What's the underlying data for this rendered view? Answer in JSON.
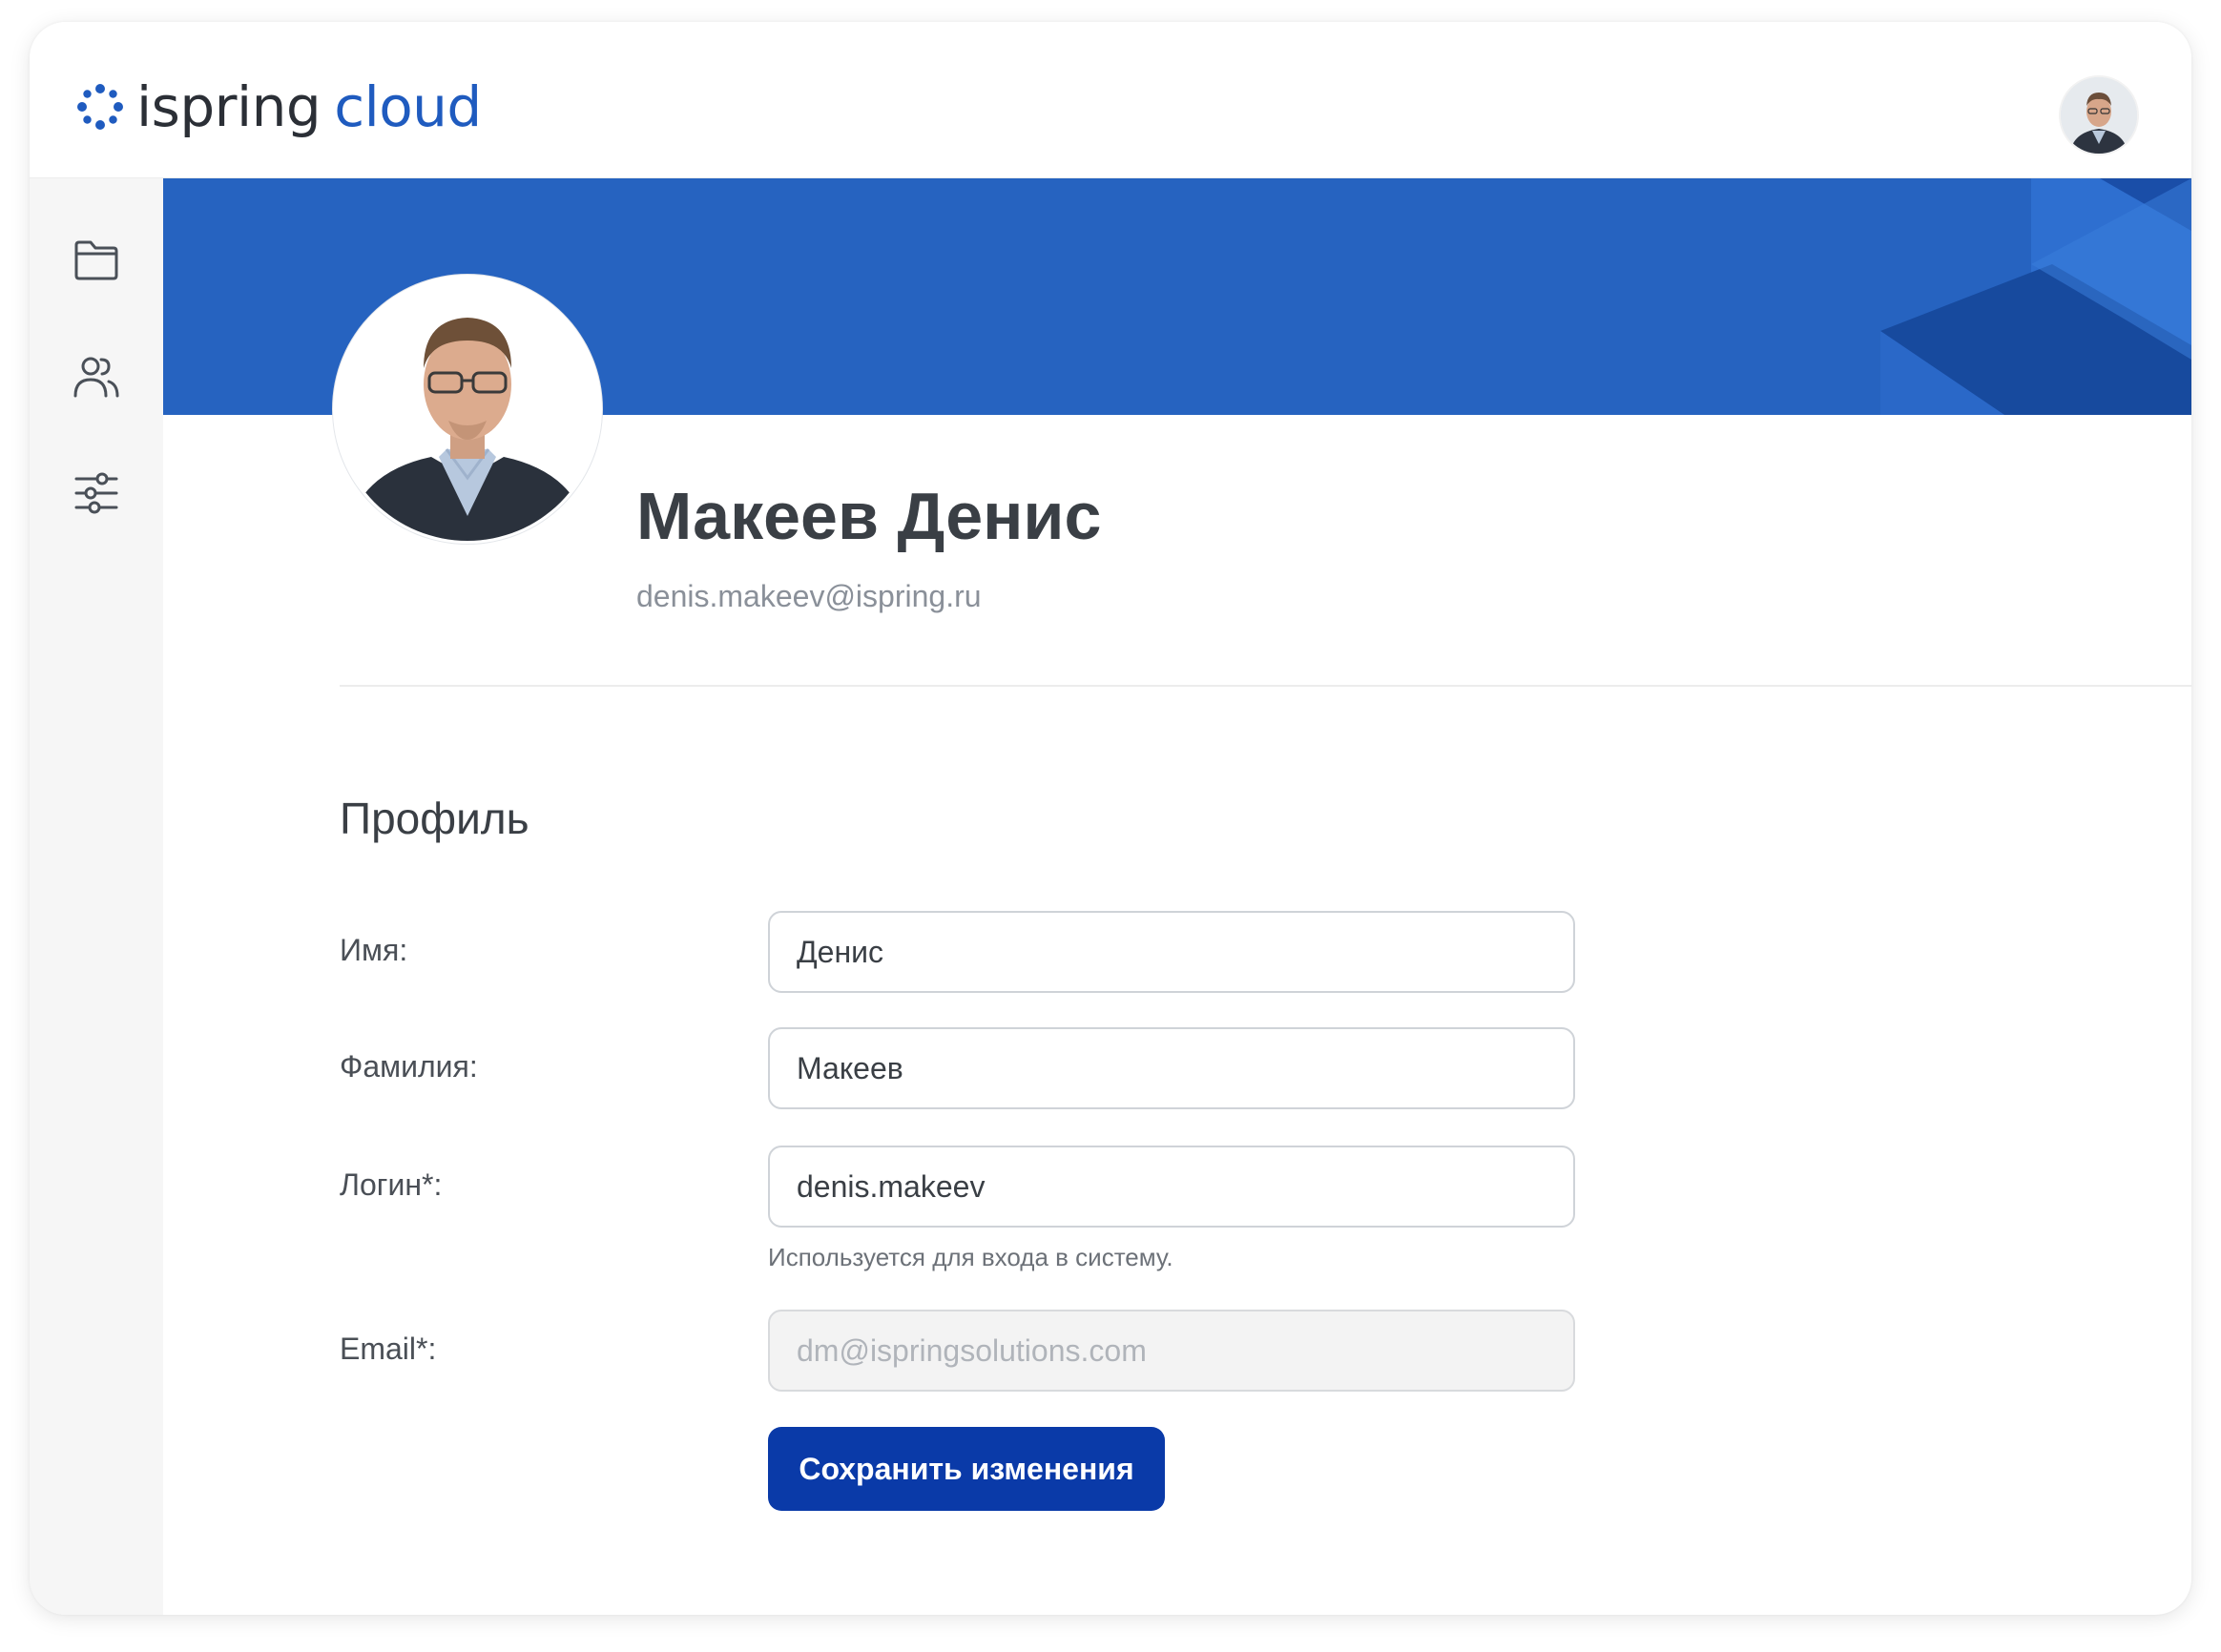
{
  "header": {
    "logo_word1": "ispring",
    "logo_word2": "cloud",
    "avatar_icon": "user-avatar-photo"
  },
  "sidebar": {
    "items": [
      {
        "icon": "folder-icon"
      },
      {
        "icon": "users-icon"
      },
      {
        "icon": "sliders-icon"
      }
    ]
  },
  "profile": {
    "name": "Макеев Денис",
    "email": "denis.makeev@ispring.ru",
    "section_title": "Профиль"
  },
  "form": {
    "first_name_label": "Имя:",
    "first_name_value": "Денис",
    "last_name_label": "Фамилия:",
    "last_name_value": "Макеев",
    "login_label": "Логин*:",
    "login_value": "denis.makeev",
    "login_hint": "Используется для входа в систему.",
    "email_label": "Email*:",
    "email_placeholder": "dm@ispringsolutions.com",
    "save_label": "Сохранить изменения"
  },
  "colors": {
    "brand_blue": "#2663c0",
    "button_blue": "#0a3aa8",
    "logo_accent": "#1f5bbf"
  }
}
